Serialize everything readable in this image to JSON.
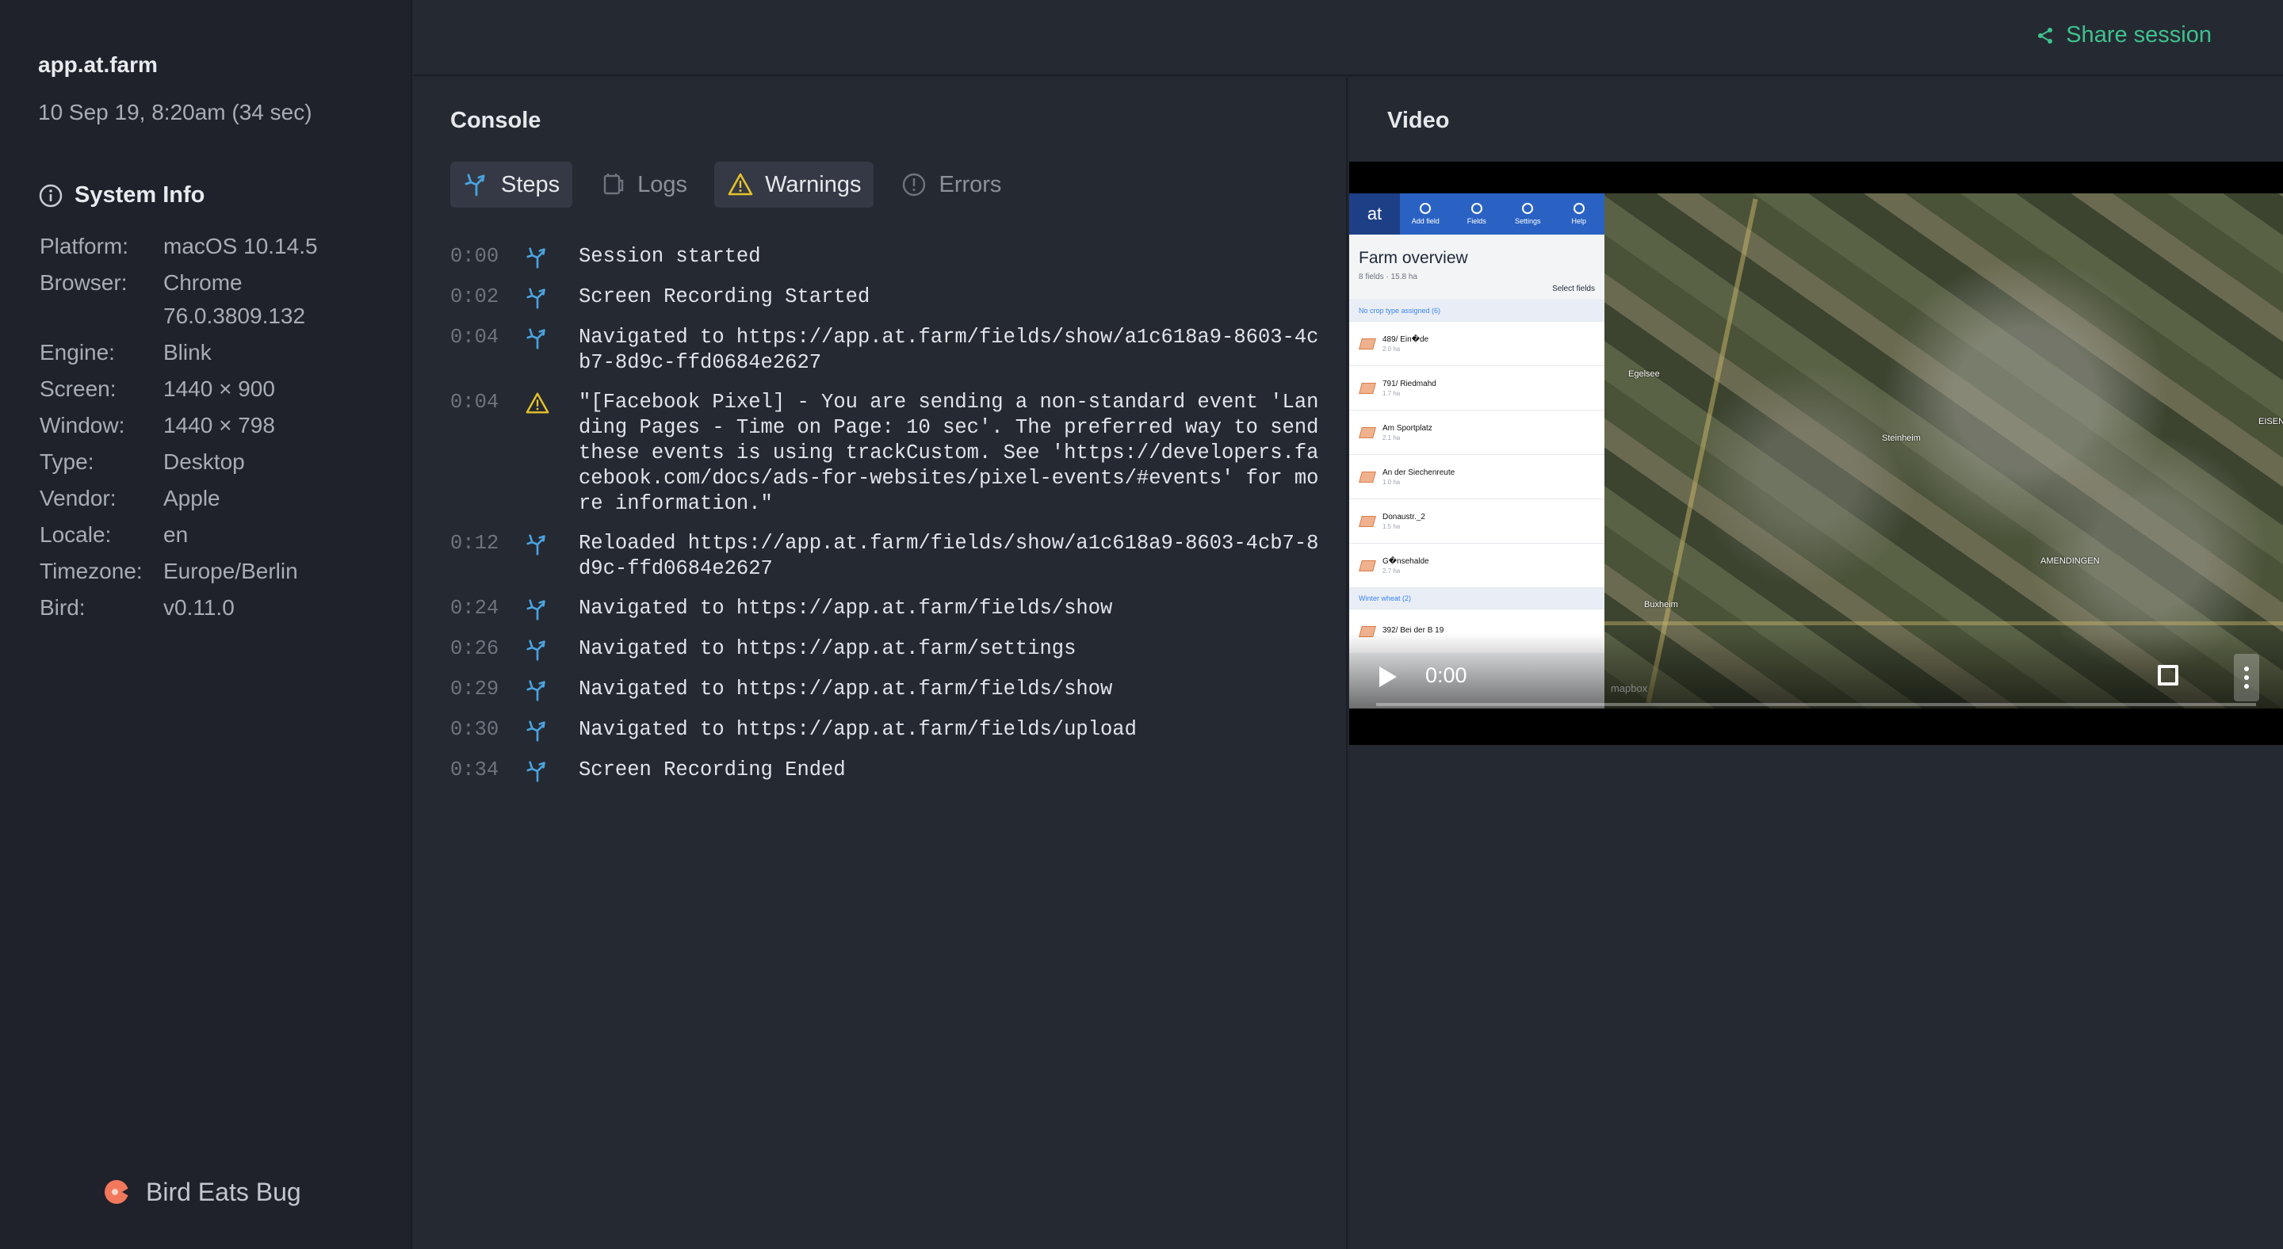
{
  "session": {
    "site": "app.at.farm",
    "date": "10 Sep 19, 8:20am (34 sec)"
  },
  "system_info": {
    "title": "System Info",
    "rows": [
      {
        "key": "Platform:",
        "value": "macOS 10.14.5"
      },
      {
        "key": "Browser:",
        "value": "Chrome 76.0.3809.132"
      },
      {
        "key": "Engine:",
        "value": "Blink"
      },
      {
        "key": "Screen:",
        "value": "1440 × 900"
      },
      {
        "key": "Window:",
        "value": "1440 × 798"
      },
      {
        "key": "Type:",
        "value": "Desktop"
      },
      {
        "key": "Vendor:",
        "value": "Apple"
      },
      {
        "key": "Locale:",
        "value": "en"
      },
      {
        "key": "Timezone:",
        "value": "Europe/Berlin"
      },
      {
        "key": "Bird:",
        "value": "v0.11.0"
      }
    ]
  },
  "brand": "Bird Eats Bug",
  "share_label": "Share session",
  "console": {
    "title": "Console",
    "tabs": [
      {
        "label": "Steps",
        "icon": "steps-icon",
        "active": true
      },
      {
        "label": "Logs",
        "icon": "logs-icon",
        "active": false
      },
      {
        "label": "Warnings",
        "icon": "warning-icon",
        "active": true
      },
      {
        "label": "Errors",
        "icon": "error-icon",
        "active": false
      }
    ],
    "entries": [
      {
        "time": "0:00",
        "type": "step",
        "message": "Session started"
      },
      {
        "time": "0:02",
        "type": "step",
        "message": "Screen Recording Started"
      },
      {
        "time": "0:04",
        "type": "step",
        "message": "Navigated to https://app.at.farm/fields/show/a1c618a9-8603-4cb7-8d9c-ffd0684e2627"
      },
      {
        "time": "0:04",
        "type": "warning",
        "message": "\"[Facebook Pixel] - You are sending a non-standard event 'Landing Pages - Time on Page: 10 sec'. The preferred way to send these events is using trackCustom. See 'https://developers.facebook.com/docs/ads-for-websites/pixel-events/#events' for more information.\""
      },
      {
        "time": "0:12",
        "type": "step",
        "message": "Reloaded https://app.at.farm/fields/show/a1c618a9-8603-4cb7-8d9c-ffd0684e2627"
      },
      {
        "time": "0:24",
        "type": "step",
        "message": "Navigated to https://app.at.farm/fields/show"
      },
      {
        "time": "0:26",
        "type": "step",
        "message": "Navigated to https://app.at.farm/settings"
      },
      {
        "time": "0:29",
        "type": "step",
        "message": "Navigated to https://app.at.farm/fields/show"
      },
      {
        "time": "0:30",
        "type": "step",
        "message": "Navigated to https://app.at.farm/fields/upload"
      },
      {
        "time": "0:34",
        "type": "step",
        "message": "Screen Recording Ended"
      }
    ]
  },
  "video": {
    "title": "Video",
    "time": "0:00",
    "progress": 0,
    "app": {
      "logo": "at",
      "nav": [
        "Add field",
        "Fields",
        "Settings",
        "Help"
      ],
      "heading": "Farm overview",
      "sub": "8 fields · 15.8 ha",
      "select": "Select fields",
      "group1": "No crop type assigned (6)",
      "fields": [
        {
          "name": "489/ Ein�de",
          "ha": "2.0 ha"
        },
        {
          "name": "791/ Riedmahd",
          "ha": "1.7 ha"
        },
        {
          "name": "Am Sportplatz",
          "ha": "2.1 ha"
        },
        {
          "name": "An der Siechenreute",
          "ha": "1.0 ha"
        },
        {
          "name": "Donaustr._2",
          "ha": "1.5 ha"
        },
        {
          "name": "G�nsehalde",
          "ha": "2.7 ha"
        }
      ],
      "group2": "Winter wheat (2)",
      "fields2": [
        {
          "name": "392/ Bei der B 19",
          "ha": ""
        }
      ]
    },
    "map_places": [
      "Steinheim",
      "AMENDINGEN",
      "Buxheim",
      "Egelsee",
      "EISENB"
    ],
    "map_attribution": "mapbox"
  },
  "colors": {
    "accent": "#3ec28f",
    "step": "#4aa3df",
    "warning": "#e6c229"
  }
}
